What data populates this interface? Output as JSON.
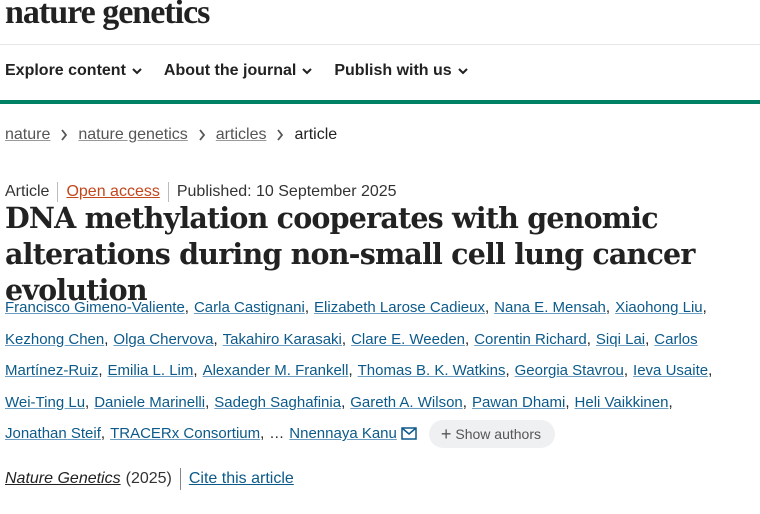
{
  "header": {
    "logo_text": "nature genetics",
    "nav": [
      {
        "label": "Explore content"
      },
      {
        "label": "About the journal"
      },
      {
        "label": "Publish with us"
      }
    ],
    "accent_color": "#008065"
  },
  "breadcrumb": [
    "nature",
    "nature genetics",
    "articles",
    "article"
  ],
  "article": {
    "type": "Article",
    "access": "Open access",
    "published": "Published: 10 September 2025",
    "title": "DNA methylation cooperates with genomic alterations during non-small cell lung cancer evolution",
    "authors": [
      "Francisco Gimeno-Valiente",
      "Carla Castignani",
      "Elizabeth Larose Cadieux",
      "Nana E. Mensah",
      "Xiaohong Liu",
      "Kezhong Chen",
      "Olga Chervova",
      "Takahiro Karasaki",
      "Clare E. Weeden",
      "Corentin Richard",
      "Siqi Lai",
      "Carlos",
      "Martínez-Ruiz",
      "Emilia L. Lim",
      "Alexander M. Frankell",
      "Thomas B. K. Watkins",
      "Georgia Stavrou",
      "Ieva Usaite",
      "Wei-Ting Lu",
      "Daniele Marinelli",
      "Sadegh Saghafinia",
      "Gareth A. Wilson",
      "Pawan Dhami",
      "Heli Vaikkinen",
      "Jonathan Steif",
      "TRACERx Consortium",
      "Nnennaya Kanu"
    ],
    "ellipsis": "…",
    "show_authors": "Show authors",
    "journal": "Nature Genetics",
    "year": "(2025)",
    "cite": "Cite this article"
  }
}
